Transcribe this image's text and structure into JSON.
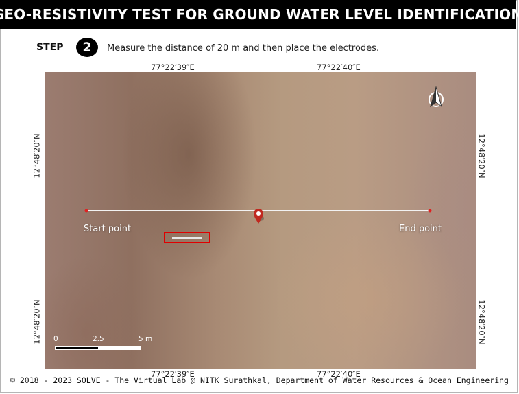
{
  "header": {
    "title": "GEO-RESISTIVITY TEST FOR GROUND WATER LEVEL IDENTIFICATION"
  },
  "step": {
    "label": "STEP",
    "number": "2",
    "instruction": "Measure the distance of 20 m and then place the electrodes."
  },
  "map": {
    "coords": {
      "top_left": "77°22′39″E",
      "top_right": "77°22′40″E",
      "bottom_left": "77°22′39″E",
      "bottom_right": "77°22′40″E",
      "left_upper": "12°48′20″N",
      "left_lower": "12°48′20″N",
      "right_upper": "12°48′20″N",
      "right_lower": "12°48′20″N"
    },
    "start_label": "Start point",
    "end_label": "End point",
    "scale": {
      "zero": "0",
      "mid": "2.5",
      "end": "5 m"
    },
    "icons": {
      "north_arrow": "north-arrow-icon",
      "location_pin": "map-pin-icon"
    },
    "colors": {
      "line": "#f2f2f2",
      "endpoint": "#e02020",
      "pin": "#c0281f",
      "highlight": "#e00000"
    }
  },
  "footer": {
    "text": "© 2018 - 2023 SOLVE - The Virtual Lab @ NITK Surathkal, Department of Water Resources & Ocean Engineering"
  }
}
